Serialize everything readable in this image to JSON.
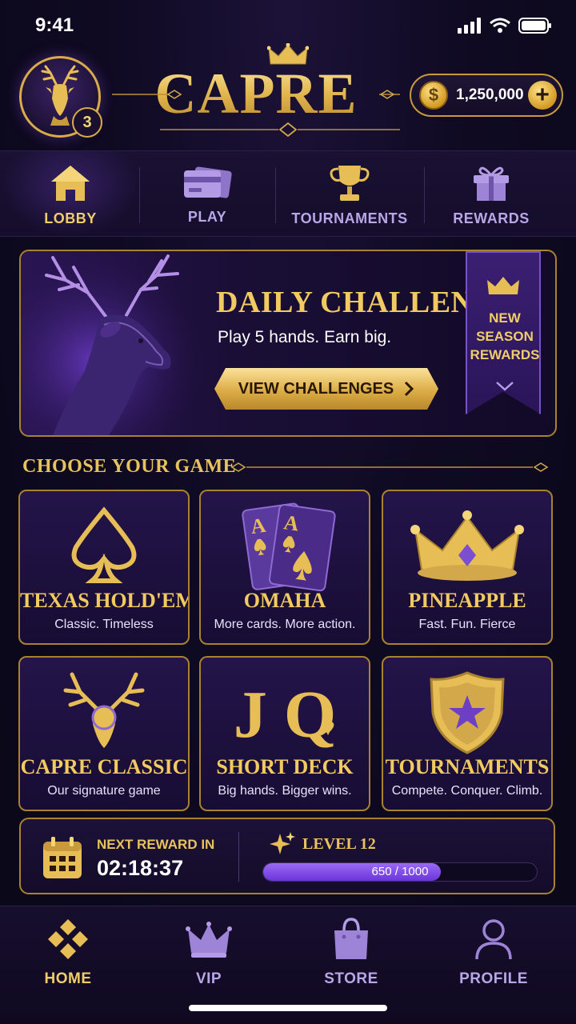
{
  "status": {
    "time": "9:41"
  },
  "header": {
    "brand": "CAPRE",
    "avatar_level": "3",
    "coins": "1,250,000",
    "coin_symbol": "$",
    "plus": "+"
  },
  "topnav": [
    {
      "label": "LOBBY",
      "icon": "home-icon",
      "active": true
    },
    {
      "label": "PLAY",
      "icon": "cards-icon",
      "active": false
    },
    {
      "label": "TOURNAMENTS",
      "icon": "trophy-icon",
      "active": false
    },
    {
      "label": "REWARDS",
      "icon": "gift-icon",
      "active": false
    }
  ],
  "banner": {
    "title": "DAILY CHALLENGE",
    "subtitle": "Play 5 hands. Earn big.",
    "button": "VIEW CHALLENGES",
    "ribbon_line1": "NEW",
    "ribbon_line2": "SEASON",
    "ribbon_line3": "REWARDS"
  },
  "section_title": "CHOOSE YOUR GAME",
  "games": [
    {
      "title": "TEXAS HOLD'EM",
      "desc": "Classic. Timeless",
      "icon": "spade-icon"
    },
    {
      "title": "OMAHA",
      "desc": "More cards. More action.",
      "icon": "aces-icon",
      "card_letter": "A"
    },
    {
      "title": "PINEAPPLE",
      "desc": "Fast. Fun. Fierce",
      "icon": "crown-icon"
    },
    {
      "title": "CAPRE CLASSIC",
      "desc": "Our signature game",
      "icon": "stag-icon"
    },
    {
      "title": "SHORT DECK",
      "desc": "Big hands. Bigger wins.",
      "icon": "jq-icon",
      "letters": "J Q"
    },
    {
      "title": "TOURNAMENTS",
      "desc": "Compete. Conquer. Climb.",
      "icon": "shield-star-icon"
    }
  ],
  "reward": {
    "next_label": "NEXT REWARD IN",
    "timer": "02:18:37",
    "level": "LEVEL 12",
    "xp_text": "650 / 1000",
    "xp_fraction": 0.65
  },
  "bottomnav": [
    {
      "label": "HOME",
      "icon": "diamond-grid-icon",
      "active": true
    },
    {
      "label": "VIP",
      "icon": "vip-crown-icon",
      "active": false
    },
    {
      "label": "STORE",
      "icon": "bag-icon",
      "active": false
    },
    {
      "label": "PROFILE",
      "icon": "user-icon",
      "active": false
    }
  ],
  "colors": {
    "gold": "#e8c25a",
    "purple": "#7a52c8",
    "background": "#0f0a22"
  }
}
